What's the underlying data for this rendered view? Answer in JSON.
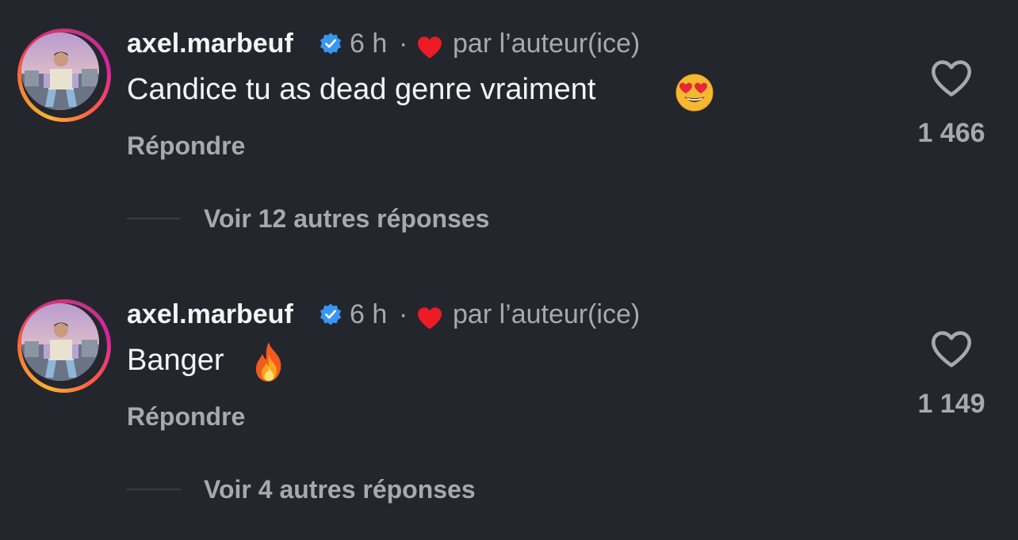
{
  "comments": [
    {
      "username": "axel.marbeuf",
      "time": "6 h",
      "separator": "·",
      "author_like": "par l’auteur(ice)",
      "text": "Candice tu as dead genre vraiment",
      "emoji": "heart-eyes-emoji",
      "reply_label": "Répondre",
      "view_more": "Voir 12 autres réponses",
      "like_count": "1 466"
    },
    {
      "username": "axel.marbeuf",
      "time": "6 h",
      "separator": "·",
      "author_like": "par l’auteur(ice)",
      "text": "Banger",
      "emoji": "fire-emoji",
      "reply_label": "Répondre",
      "view_more": "Voir 4 autres réponses",
      "like_count": "1 149"
    }
  ],
  "colors": {
    "background": "#24262d",
    "primary_text": "#f5f5f5",
    "secondary_text": "#a8a9ad",
    "verified_blue": "#3897f0",
    "heart_red": "#ed1c24"
  }
}
